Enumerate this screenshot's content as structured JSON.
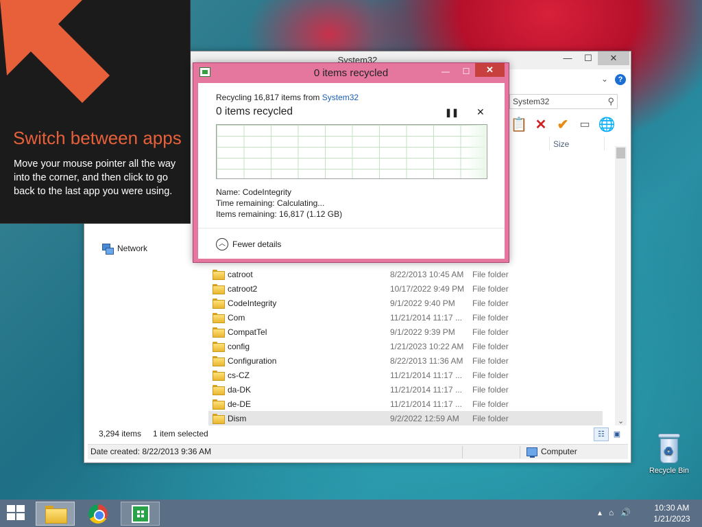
{
  "desktop": {
    "recycle_bin_label": "Recycle Bin"
  },
  "explorer": {
    "title": "System32",
    "search_placeholder": "System32",
    "column_size": "Size",
    "nav_network": "Network",
    "files": [
      {
        "name": "catroot",
        "date": "8/22/2013 10:45 AM",
        "type": "File folder"
      },
      {
        "name": "catroot2",
        "date": "10/17/2022 9:49 PM",
        "type": "File folder"
      },
      {
        "name": "CodeIntegrity",
        "date": "9/1/2022 9:40 PM",
        "type": "File folder"
      },
      {
        "name": "Com",
        "date": "11/21/2014 11:17 ...",
        "type": "File folder"
      },
      {
        "name": "CompatTel",
        "date": "9/1/2022 9:39 PM",
        "type": "File folder"
      },
      {
        "name": "config",
        "date": "1/21/2023 10:22 AM",
        "type": "File folder"
      },
      {
        "name": "Configuration",
        "date": "8/22/2013 11:36 AM",
        "type": "File folder"
      },
      {
        "name": "cs-CZ",
        "date": "11/21/2014 11:17 ...",
        "type": "File folder"
      },
      {
        "name": "da-DK",
        "date": "11/21/2014 11:17 ...",
        "type": "File folder"
      },
      {
        "name": "de-DE",
        "date": "11/21/2014 11:17 ...",
        "type": "File folder"
      },
      {
        "name": "Dism",
        "date": "9/2/2022 12:59 AM",
        "type": "File folder"
      }
    ],
    "status_count": "3,294 items",
    "status_selected": "1 item selected",
    "date_created": "Date created: 8/22/2013 9:36 AM",
    "location": "Computer"
  },
  "tip": {
    "title": "Switch between apps",
    "body": "Move your mouse pointer all the way into the corner, and then click to go back to the last app you were using."
  },
  "dialog": {
    "title": "0 items recycled",
    "line_prefix": "Recycling 16,817 items from ",
    "line_link": "System32",
    "heading": "0 items recycled",
    "name_label": "Name:",
    "name_value": "CodeIntegrity",
    "time_label": "Time remaining:",
    "time_value": "Calculating...",
    "items_label": "Items remaining:",
    "items_value": "16,817 (1.12 GB)",
    "fewer_details": "Fewer details"
  },
  "taskbar": {
    "time": "10:30 AM",
    "date": "1/21/2023"
  },
  "colors": {
    "dialog_frame": "#e5779f",
    "tip_accent": "#e8603a"
  }
}
